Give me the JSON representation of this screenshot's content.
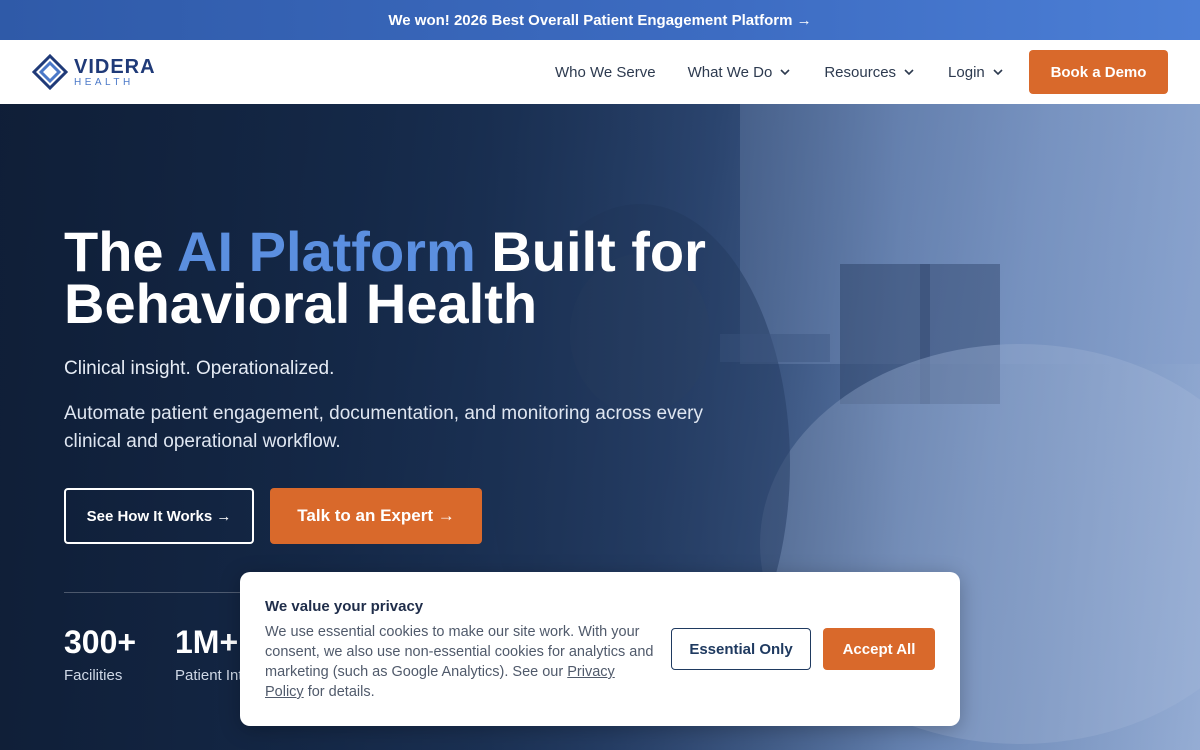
{
  "announcement": {
    "text": "We won! 2026 Best Overall Patient Engagement Platform →"
  },
  "brand": {
    "name": "VIDERA",
    "sub": "HEALTH"
  },
  "nav": {
    "items": [
      {
        "label": "Who We Serve",
        "dropdown": false
      },
      {
        "label": "What We Do",
        "dropdown": true
      },
      {
        "label": "Resources",
        "dropdown": true
      },
      {
        "label": "Login",
        "dropdown": true
      }
    ],
    "cta": "Book a Demo"
  },
  "hero": {
    "title_pre": "The ",
    "title_accent": "AI Platform",
    "title_post": " Built for",
    "title_line2": "Behavioral Health",
    "tagline": "Clinical insight. Operationalized.",
    "description": "Automate patient engagement, documentation, and monitoring across every clinical and operational workflow.",
    "btn_secondary": "See How It Works →",
    "btn_primary": "Talk to an Expert →",
    "stats": [
      {
        "value": "300+",
        "label": "Facilities"
      },
      {
        "value": "1M+",
        "label": "Patient Int"
      }
    ]
  },
  "cookie": {
    "title": "We value your privacy",
    "body": "We use essential cookies to make our site work. With your consent, we also use non-essential cookies for analytics and marketing (such as Google Analytics). See our ",
    "link": "Privacy Policy",
    "body_end": " for details.",
    "btn_essential": "Essential Only",
    "btn_accept": "Accept All"
  },
  "colors": {
    "accent_orange": "#d9692b",
    "brand_blue": "#1f3a78",
    "accent_blue": "#5b8fe0"
  }
}
